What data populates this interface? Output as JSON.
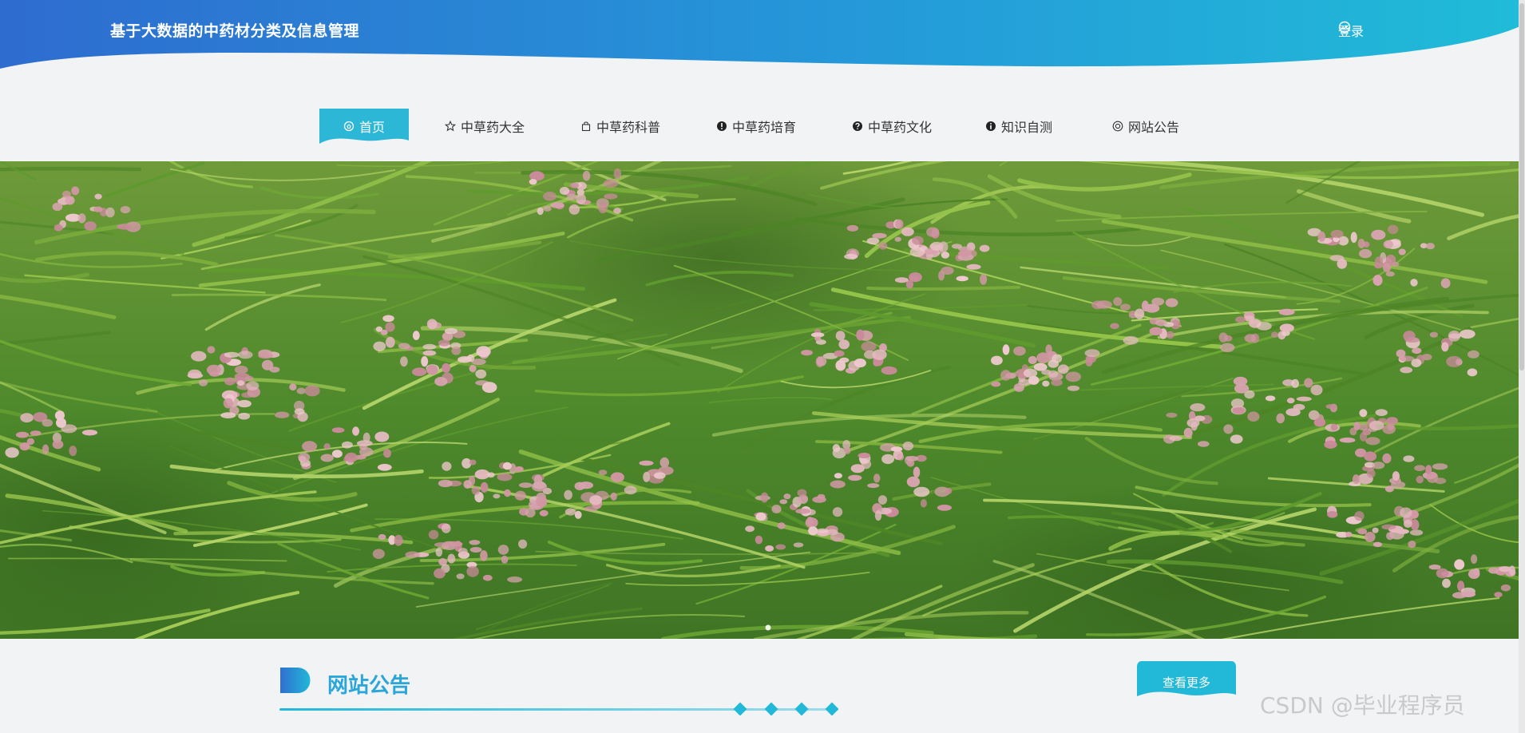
{
  "header": {
    "title": "基于大数据的中药材分类及信息管理",
    "login_label": "登录",
    "colors": {
      "gradient_start": "#2f6fd0",
      "gradient_end": "#22b8d8"
    }
  },
  "nav": {
    "items": [
      {
        "label": "首页",
        "icon": "home-icon",
        "active": true
      },
      {
        "label": "中草药大全",
        "icon": "star-icon"
      },
      {
        "label": "中草药科普",
        "icon": "bag-icon"
      },
      {
        "label": "中草药培育",
        "icon": "info-circle-icon"
      },
      {
        "label": "中草药文化",
        "icon": "question-circle-icon"
      },
      {
        "label": "知识自测",
        "icon": "info-circle-icon"
      },
      {
        "label": "网站公告",
        "icon": "settings-circle-icon"
      }
    ],
    "active_color": "#2cb7d6"
  },
  "banner": {
    "image": "green grass with small pink flowers",
    "carousel_dots": 1
  },
  "notice": {
    "title": "网站公告",
    "more_label": "查看更多"
  },
  "watermark": "CSDN @毕业程序员"
}
